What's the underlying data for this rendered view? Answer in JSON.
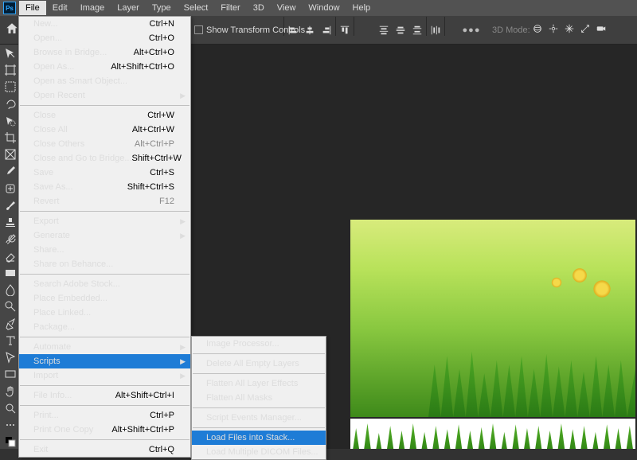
{
  "menubar": [
    "File",
    "Edit",
    "Image",
    "Layer",
    "Type",
    "Select",
    "Filter",
    "3D",
    "View",
    "Window",
    "Help"
  ],
  "menubar_active": 0,
  "options": {
    "showTransform": "Show Transform Controls",
    "threeDmode": "3D Mode:"
  },
  "file_menu": [
    {
      "label": "New...",
      "shortcut": "Ctrl+N"
    },
    {
      "label": "Open...",
      "shortcut": "Ctrl+O"
    },
    {
      "label": "Browse in Bridge...",
      "shortcut": "Alt+Ctrl+O"
    },
    {
      "label": "Open As...",
      "shortcut": "Alt+Shift+Ctrl+O"
    },
    {
      "label": "Open as Smart Object..."
    },
    {
      "label": "Open Recent",
      "submenu": true
    },
    {
      "sep": true
    },
    {
      "label": "Close",
      "shortcut": "Ctrl+W"
    },
    {
      "label": "Close All",
      "shortcut": "Alt+Ctrl+W"
    },
    {
      "label": "Close Others",
      "shortcut": "Alt+Ctrl+P",
      "disabled": true
    },
    {
      "label": "Close and Go to Bridge...",
      "shortcut": "Shift+Ctrl+W"
    },
    {
      "label": "Save",
      "shortcut": "Ctrl+S"
    },
    {
      "label": "Save As...",
      "shortcut": "Shift+Ctrl+S"
    },
    {
      "label": "Revert",
      "shortcut": "F12",
      "disabled": true
    },
    {
      "sep": true
    },
    {
      "label": "Export",
      "submenu": true
    },
    {
      "label": "Generate",
      "submenu": true
    },
    {
      "label": "Share..."
    },
    {
      "label": "Share on Behance..."
    },
    {
      "sep": true
    },
    {
      "label": "Search Adobe Stock..."
    },
    {
      "label": "Place Embedded..."
    },
    {
      "label": "Place Linked..."
    },
    {
      "label": "Package...",
      "disabled": true
    },
    {
      "sep": true
    },
    {
      "label": "Automate",
      "submenu": true
    },
    {
      "label": "Scripts",
      "submenu": true,
      "highlight": true
    },
    {
      "label": "Import",
      "submenu": true
    },
    {
      "sep": true
    },
    {
      "label": "File Info...",
      "shortcut": "Alt+Shift+Ctrl+I"
    },
    {
      "sep": true
    },
    {
      "label": "Print...",
      "shortcut": "Ctrl+P"
    },
    {
      "label": "Print One Copy",
      "shortcut": "Alt+Shift+Ctrl+P"
    },
    {
      "sep": true
    },
    {
      "label": "Exit",
      "shortcut": "Ctrl+Q"
    }
  ],
  "scripts_menu": [
    {
      "label": "Image Processor..."
    },
    {
      "sep": true
    },
    {
      "label": "Delete All Empty Layers"
    },
    {
      "sep": true
    },
    {
      "label": "Flatten All Layer Effects"
    },
    {
      "label": "Flatten All Masks"
    },
    {
      "sep": true
    },
    {
      "label": "Script Events Manager..."
    },
    {
      "sep": true
    },
    {
      "label": "Load Files into Stack...",
      "highlight": true
    },
    {
      "label": "Load Multiple DICOM Files..."
    }
  ],
  "tools": [
    "move",
    "artboard",
    "marquee",
    "lasso",
    "quick-select",
    "crop",
    "frame",
    "eyedropper",
    "healing",
    "brush",
    "stamp",
    "history-brush",
    "eraser",
    "gradient",
    "blur",
    "dodge",
    "pen",
    "type",
    "path-select",
    "rectangle",
    "hand",
    "zoom",
    "edit-toolbar",
    "fg-bg"
  ]
}
